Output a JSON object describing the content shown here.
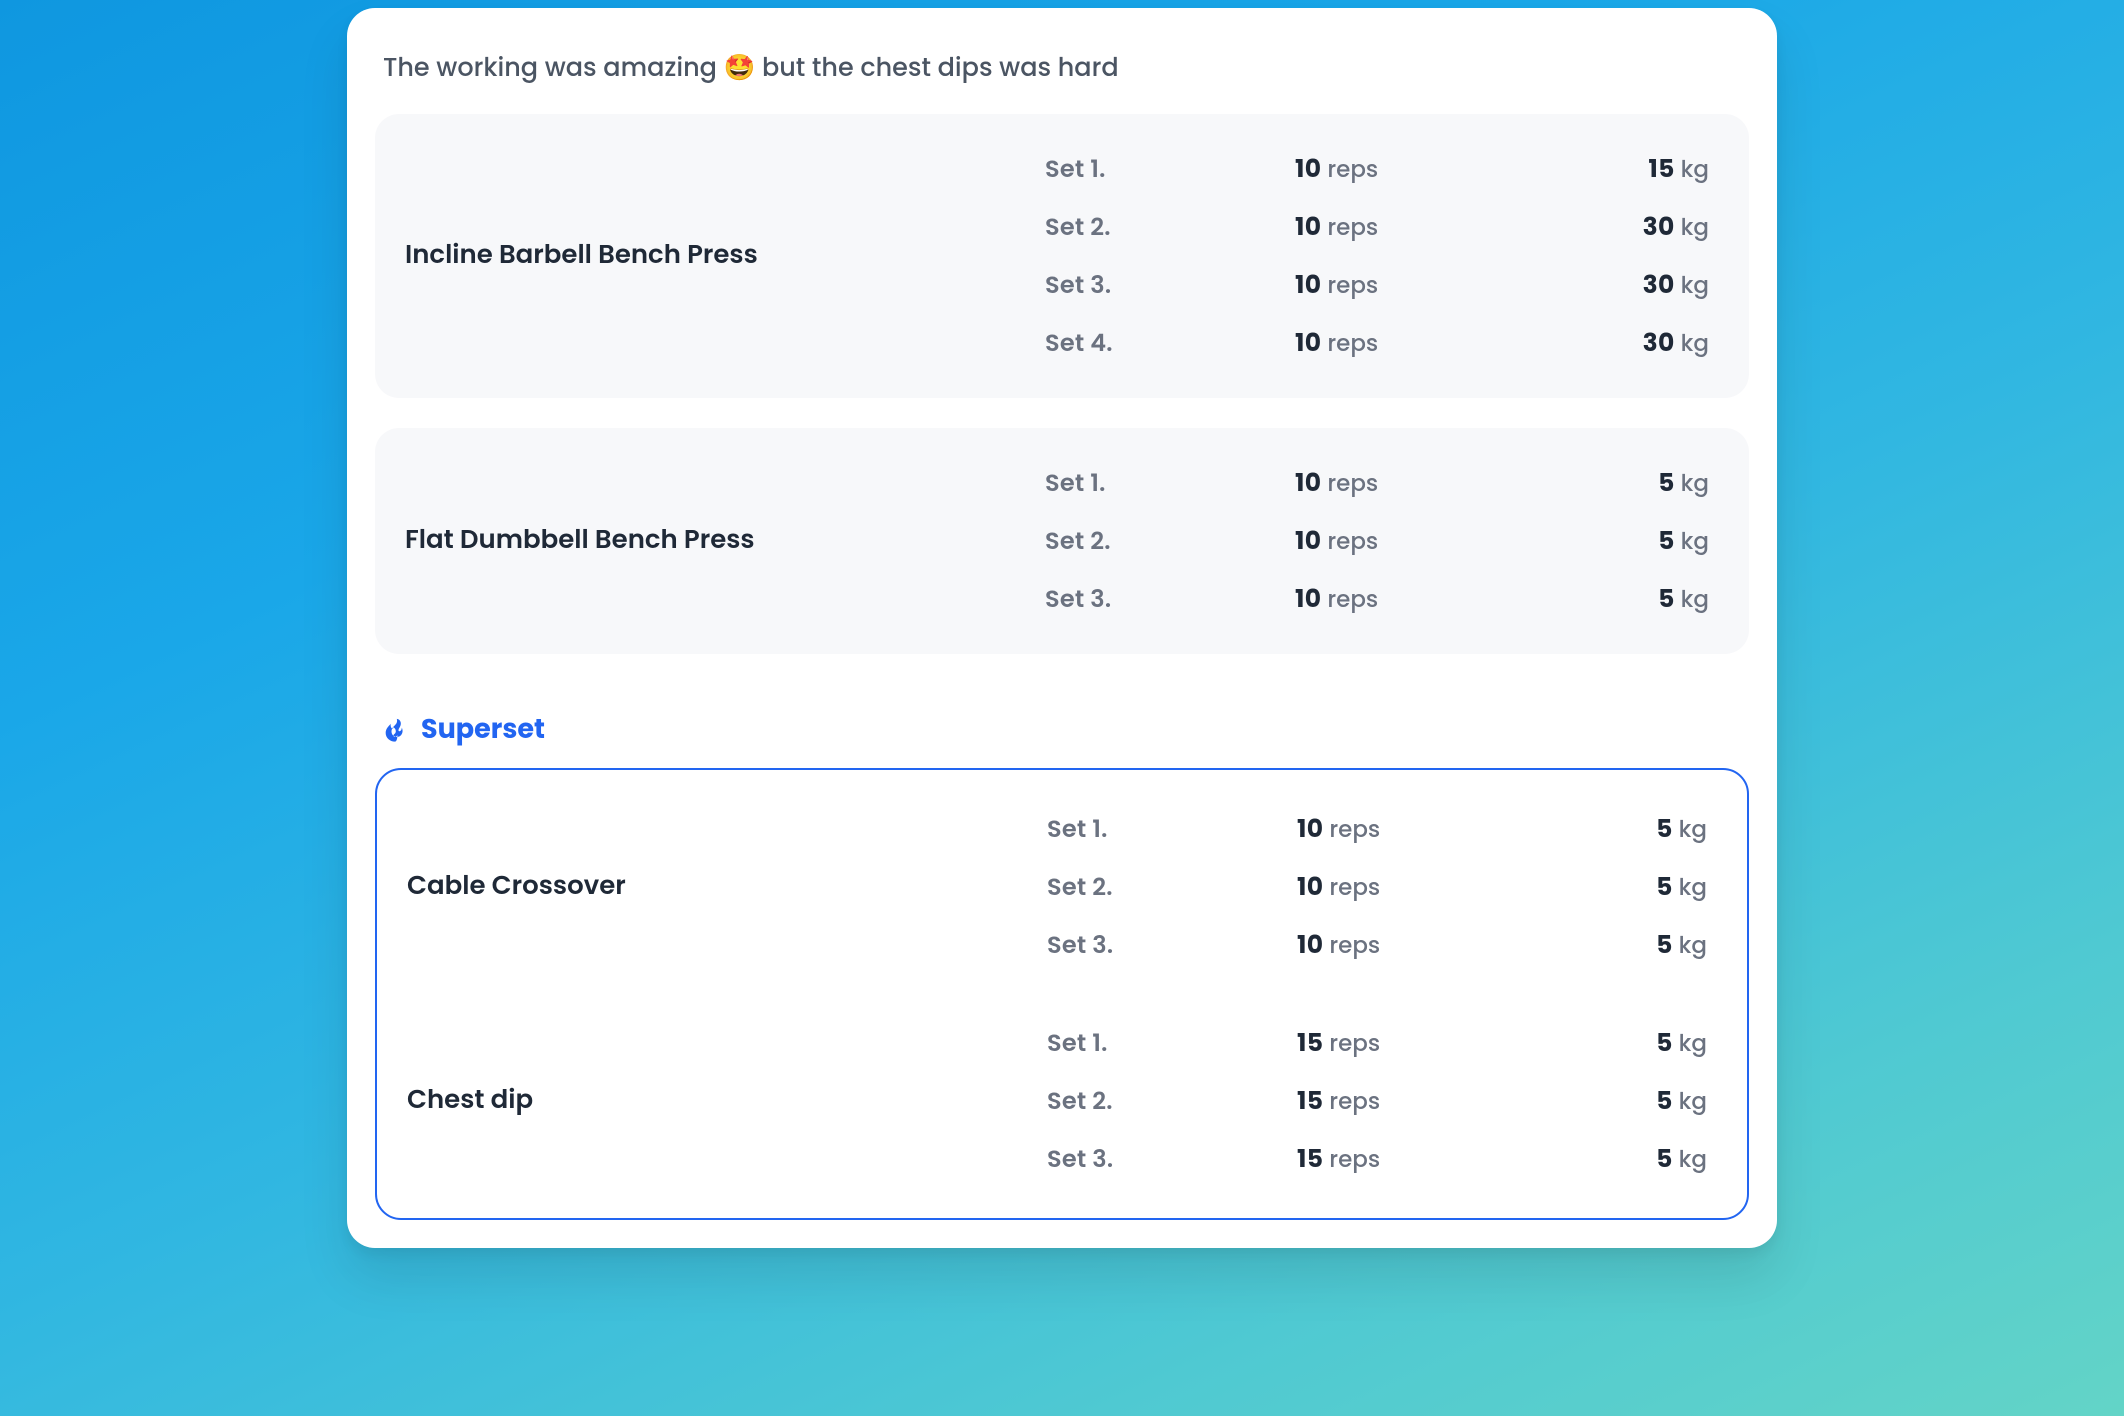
{
  "comment": "The working was amazing 🤩 but the chest dips was hard",
  "labels": {
    "set_prefix": "Set",
    "reps_unit": "reps",
    "weight_unit": "kg",
    "superset": "Superset"
  },
  "exercises": [
    {
      "name": "Incline Barbell Bench Press",
      "sets": [
        {
          "n": 1,
          "reps": 10,
          "weight": 15
        },
        {
          "n": 2,
          "reps": 10,
          "weight": 30
        },
        {
          "n": 3,
          "reps": 10,
          "weight": 30
        },
        {
          "n": 4,
          "reps": 10,
          "weight": 30
        }
      ]
    },
    {
      "name": "Flat Dumbbell Bench Press",
      "sets": [
        {
          "n": 1,
          "reps": 10,
          "weight": 5
        },
        {
          "n": 2,
          "reps": 10,
          "weight": 5
        },
        {
          "n": 3,
          "reps": 10,
          "weight": 5
        }
      ]
    }
  ],
  "superset": {
    "exercises": [
      {
        "name": "Cable Crossover",
        "sets": [
          {
            "n": 1,
            "reps": 10,
            "weight": 5
          },
          {
            "n": 2,
            "reps": 10,
            "weight": 5
          },
          {
            "n": 3,
            "reps": 10,
            "weight": 5
          }
        ]
      },
      {
        "name": "Chest dip",
        "sets": [
          {
            "n": 1,
            "reps": 15,
            "weight": 5
          },
          {
            "n": 2,
            "reps": 15,
            "weight": 5
          },
          {
            "n": 3,
            "reps": 15,
            "weight": 5
          }
        ]
      }
    ]
  }
}
